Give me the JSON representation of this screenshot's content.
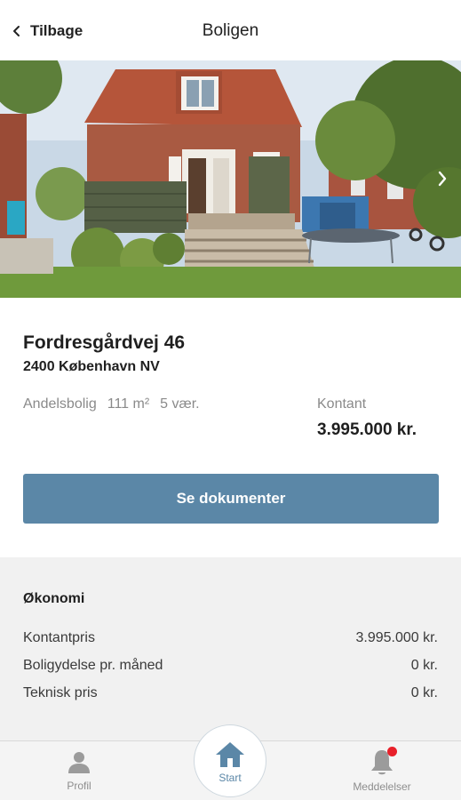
{
  "header": {
    "back_label": "Tilbage",
    "title": "Boligen"
  },
  "property": {
    "address": "Fordresgårdvej 46",
    "city": "2400 København NV",
    "type": "Andelsbolig",
    "area": "111 m²",
    "rooms": "5 vær.",
    "price_label": "Kontant",
    "price_value": "3.995.000 kr."
  },
  "actions": {
    "documents_label": "Se dokumenter"
  },
  "economy": {
    "title": "Økonomi",
    "rows": [
      {
        "label": "Kontantpris",
        "value": "3.995.000 kr."
      },
      {
        "label": "Boligydelse pr. måned",
        "value": "0 kr."
      },
      {
        "label": "Teknisk pris",
        "value": "0 kr."
      }
    ]
  },
  "tabbar": {
    "profile_label": "Profil",
    "start_label": "Start",
    "notifications_label": "Meddelelser",
    "notifications_badge": true
  },
  "icons": {
    "back": "chevron-left-icon",
    "next": "chevron-right-icon",
    "profile": "person-icon",
    "start": "house-icon",
    "notifications": "bell-icon"
  },
  "colors": {
    "accent": "#5b87a7",
    "badge": "#e8202a",
    "section_bg": "#f1f1f1",
    "muted_text": "#8a8a8a"
  }
}
